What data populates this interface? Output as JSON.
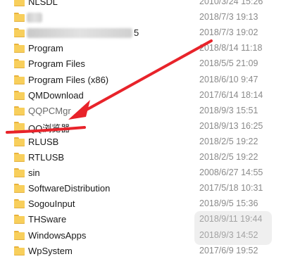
{
  "files": [
    {
      "name": "NLSDL",
      "date": "2010/3/24 15:26"
    },
    {
      "name": "",
      "date": "2018/7/3 19:13"
    },
    {
      "name": "5",
      "date": "2018/7/3 19:02"
    },
    {
      "name": "Program",
      "date": "2018/8/14 11:18"
    },
    {
      "name": "Program Files",
      "date": "2018/5/5 21:09"
    },
    {
      "name": "Program Files (x86)",
      "date": "2018/6/10 9:47"
    },
    {
      "name": "QMDownload",
      "date": "2017/6/14 18:14"
    },
    {
      "name": "QQPCMgr",
      "date": "2018/9/3 15:51"
    },
    {
      "name": "QQ浏览器",
      "date": "2018/9/13 16:25"
    },
    {
      "name": "RLUSB",
      "date": "2018/2/5 19:22"
    },
    {
      "name": "RTLUSB",
      "date": "2018/2/5 19:22"
    },
    {
      "name": "sin",
      "date": "2008/6/27 14:55"
    },
    {
      "name": "SoftwareDistribution",
      "date": "2017/5/18 10:31"
    },
    {
      "name": "SogouInput",
      "date": "2018/9/5 15:36"
    },
    {
      "name": "THSware",
      "date": "2018/9/11 19:44"
    },
    {
      "name": "WindowsApps",
      "date": "2018/9/3 14:52"
    },
    {
      "name": "WpSystem",
      "date": "2017/6/9 19:52"
    }
  ],
  "icons": {
    "folder": "folder-icon"
  },
  "colors": {
    "annotation": "#e8232a",
    "folder": "#f8cf5c"
  }
}
